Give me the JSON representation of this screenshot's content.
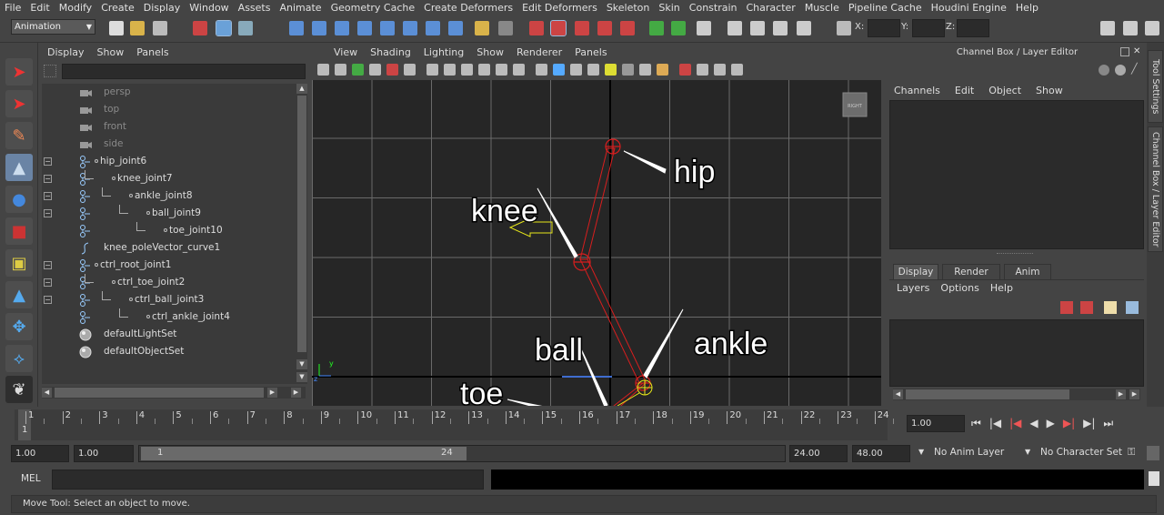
{
  "menubar": [
    "File",
    "Edit",
    "Modify",
    "Create",
    "Display",
    "Window",
    "Assets",
    "Animate",
    "Geometry Cache",
    "Create Deformers",
    "Edit Deformers",
    "Skeleton",
    "Skin",
    "Constrain",
    "Character",
    "Muscle",
    "Pipeline Cache",
    "Houdini Engine",
    "Help"
  ],
  "shelf": {
    "mode": "Animation",
    "x_label": "X:",
    "y_label": "Y:",
    "z_label": "Z:"
  },
  "outliner": {
    "menu": [
      "Display",
      "Show",
      "Panels"
    ],
    "items": [
      {
        "label": "persp",
        "indent": 0,
        "icon": "camera-icon",
        "dim": true,
        "collapse": ""
      },
      {
        "label": "top",
        "indent": 0,
        "icon": "camera-icon",
        "dim": true,
        "collapse": ""
      },
      {
        "label": "front",
        "indent": 0,
        "icon": "camera-icon",
        "dim": true,
        "collapse": ""
      },
      {
        "label": "side",
        "indent": 0,
        "icon": "camera-icon",
        "dim": true,
        "collapse": ""
      },
      {
        "label": "hip_joint6",
        "indent": 0,
        "icon": "joint-icon",
        "dim": false,
        "collapse": "−"
      },
      {
        "label": "knee_joint7",
        "indent": 1,
        "icon": "joint-icon",
        "dim": false,
        "collapse": "−"
      },
      {
        "label": "ankle_joint8",
        "indent": 2,
        "icon": "joint-icon",
        "dim": false,
        "collapse": "−"
      },
      {
        "label": "ball_joint9",
        "indent": 3,
        "icon": "joint-icon",
        "dim": false,
        "collapse": "−"
      },
      {
        "label": "toe_joint10",
        "indent": 4,
        "icon": "joint-icon",
        "dim": false,
        "collapse": ""
      },
      {
        "label": "knee_poleVector_curve1",
        "indent": 0,
        "icon": "curve-icon",
        "dim": false,
        "collapse": ""
      },
      {
        "label": "ctrl_root_joint1",
        "indent": 0,
        "icon": "joint-icon",
        "dim": false,
        "collapse": "−"
      },
      {
        "label": "ctrl_toe_joint2",
        "indent": 1,
        "icon": "joint-icon",
        "dim": false,
        "collapse": "−"
      },
      {
        "label": "ctrl_ball_joint3",
        "indent": 2,
        "icon": "joint-icon",
        "dim": false,
        "collapse": "−"
      },
      {
        "label": "ctrl_ankle_joint4",
        "indent": 3,
        "icon": "joint-icon",
        "dim": false,
        "collapse": ""
      },
      {
        "label": "defaultLightSet",
        "indent": 0,
        "icon": "set-icon",
        "dim": false,
        "collapse": ""
      },
      {
        "label": "defaultObjectSet",
        "indent": 0,
        "icon": "set-icon",
        "dim": false,
        "collapse": ""
      }
    ]
  },
  "viewport": {
    "menu": [
      "View",
      "Shading",
      "Lighting",
      "Show",
      "Renderer",
      "Panels"
    ],
    "cube_label": "RIGHT",
    "axis_y": "y",
    "axis_z": "z",
    "annotations": {
      "hip": "hip",
      "knee": "knee",
      "ankle": "ankle",
      "ball": "ball",
      "toe": "toe"
    }
  },
  "channelbox": {
    "title": "Channel Box / Layer Editor",
    "menu": [
      "Channels",
      "Edit",
      "Object",
      "Show"
    ],
    "tabs": [
      "Display",
      "Render",
      "Anim"
    ],
    "layer_menu": [
      "Layers",
      "Options",
      "Help"
    ]
  },
  "sidebar": {
    "tool_settings": "Tool Settings",
    "channel_box": "Channel Box / Layer Editor"
  },
  "timeline": {
    "ticks": [
      "1",
      "2",
      "3",
      "4",
      "5",
      "6",
      "7",
      "8",
      "9",
      "10",
      "11",
      "12",
      "13",
      "14",
      "15",
      "16",
      "17",
      "18",
      "19",
      "20",
      "21",
      "22",
      "23",
      "24"
    ],
    "current_frame": "1",
    "current_frame_field": "1.00"
  },
  "range": {
    "start": "1.00",
    "playback_start": "1.00",
    "slider_start": "1",
    "slider_end": "24",
    "playback_end": "24.00",
    "end": "48.00",
    "anim_layer": "No Anim Layer",
    "character_set": "No Character Set"
  },
  "cmd": {
    "label": "MEL"
  },
  "help": {
    "text": "Move Tool: Select an object to move."
  },
  "colors": {
    "joint": "#d81e1e",
    "arrow": "#e7e71a",
    "grid": "#6a6a6a",
    "axis": "#000000"
  }
}
